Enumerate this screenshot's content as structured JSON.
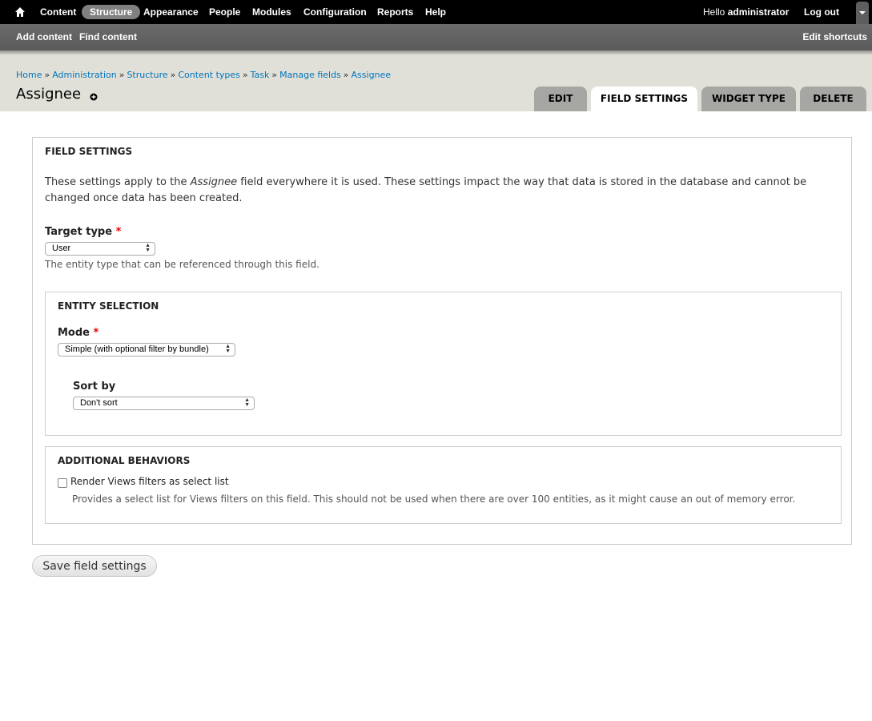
{
  "toolbar": {
    "home_icon": "home-icon",
    "menu": [
      "Content",
      "Structure",
      "Appearance",
      "People",
      "Modules",
      "Configuration",
      "Reports",
      "Help"
    ],
    "active": "Structure",
    "greeting_prefix": "Hello ",
    "user": "administrator",
    "logout": "Log out"
  },
  "shortcuts": {
    "items": [
      "Add content",
      "Find content"
    ],
    "edit": "Edit shortcuts"
  },
  "breadcrumb": {
    "items": [
      "Home",
      "Administration",
      "Structure",
      "Content types",
      "Task",
      "Manage fields",
      "Assignee"
    ],
    "separator": "»"
  },
  "page": {
    "title": "Assignee",
    "shortcut_icon": "add-shortcut-icon"
  },
  "tabs": [
    {
      "label": "Edit",
      "active": false
    },
    {
      "label": "Field settings",
      "active": true
    },
    {
      "label": "Widget type",
      "active": false
    },
    {
      "label": "Delete",
      "active": false
    }
  ],
  "field_settings": {
    "legend": "Field settings",
    "desc_before": "These settings apply to the ",
    "desc_field": "Assignee",
    "desc_after": " field everywhere it is used. These settings impact the way that data is stored in the database and cannot be changed once data has been created.",
    "target_type_label": "Target type",
    "required_mark": "*",
    "target_type_value": "User",
    "target_type_help": "The entity type that can be referenced through this field."
  },
  "entity_selection": {
    "legend": "Entity selection",
    "mode_label": "Mode",
    "mode_value": "Simple (with optional filter by bundle)",
    "sort_label": "Sort by",
    "sort_value": "Don't sort"
  },
  "additional": {
    "legend": "Additional behaviors",
    "checkbox_label": "Render Views filters as select list",
    "checked": false,
    "help": "Provides a select list for Views filters on this field. This should not be used when there are over 100 entities, as it might cause an out of memory error."
  },
  "actions": {
    "save": "Save field settings"
  },
  "colors": {
    "toolbar_bg": "#000000",
    "shortcuts_bg": "#666666",
    "header_bg": "#e0e0d8",
    "link": "#0074bd",
    "required": "#ee0000"
  }
}
